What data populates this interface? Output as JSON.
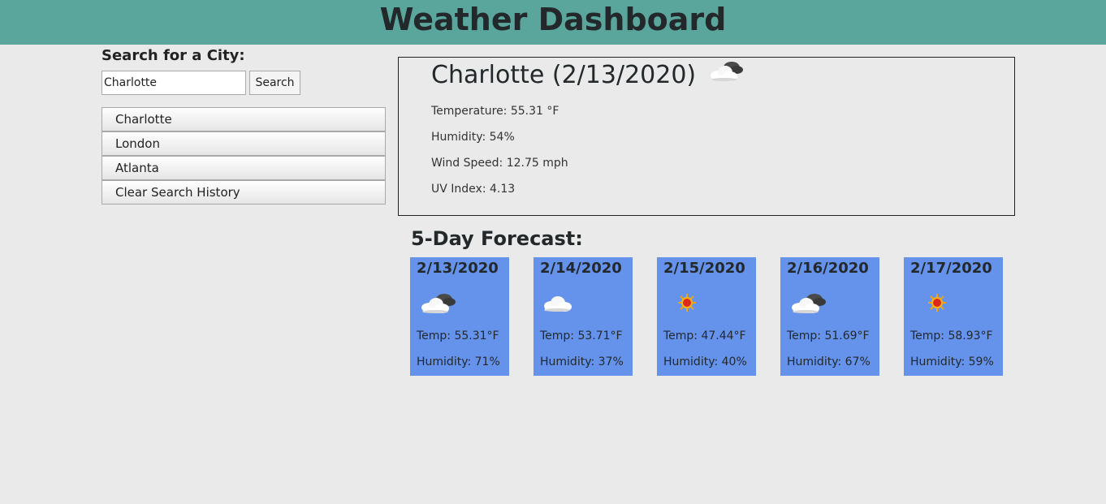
{
  "header": {
    "title": "Weather Dashboard"
  },
  "search": {
    "label": "Search for a City:",
    "input_value": "Charlotte",
    "button_label": "Search"
  },
  "history": {
    "items": [
      {
        "label": "Charlotte"
      },
      {
        "label": "London"
      },
      {
        "label": "Atlanta"
      }
    ],
    "clear_label": "Clear Search History"
  },
  "current": {
    "title": "Charlotte (2/13/2020)",
    "icon": "partly-cloudy-icon",
    "temperature": "Temperature: 55.31 °F",
    "humidity": "Humidity: 54%",
    "wind": "Wind Speed: 12.75 mph",
    "uv": "UV Index: 4.13"
  },
  "forecast": {
    "title": "5-Day Forecast:",
    "card_color": "#6593eb",
    "days": [
      {
        "date": "2/13/2020",
        "icon": "partly-cloudy-icon",
        "temp": "Temp: 55.31°F",
        "humidity": "Humidity: 71%"
      },
      {
        "date": "2/14/2020",
        "icon": "cloud-icon",
        "temp": "Temp: 53.71°F",
        "humidity": "Humidity: 37%"
      },
      {
        "date": "2/15/2020",
        "icon": "sun-icon",
        "temp": "Temp: 47.44°F",
        "humidity": "Humidity: 40%"
      },
      {
        "date": "2/16/2020",
        "icon": "partly-cloudy-icon",
        "temp": "Temp: 51.69°F",
        "humidity": "Humidity: 67%"
      },
      {
        "date": "2/17/2020",
        "icon": "sun-icon",
        "temp": "Temp: 58.93°F",
        "humidity": "Humidity: 59%"
      }
    ]
  }
}
